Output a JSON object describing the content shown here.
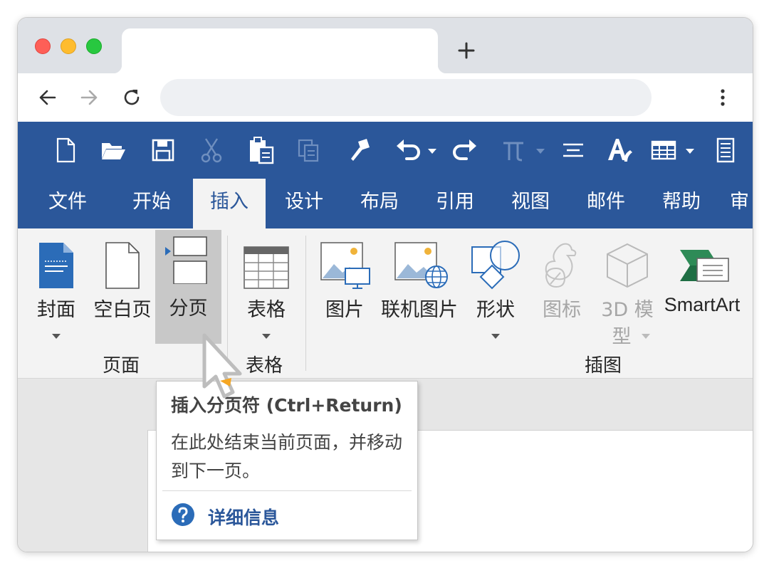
{
  "browser": {
    "new_tab_symbol": "+",
    "address": ""
  },
  "quick_access": {
    "icons": [
      "new-document-icon",
      "open-folder-icon",
      "save-icon",
      "cut-icon",
      "paste-icon",
      "copy-icon",
      "format-painter-icon",
      "undo-icon",
      "undo-dropdown-icon",
      "redo-icon",
      "equation-icon",
      "equation-dropdown-icon",
      "center-align-icon",
      "text-effects-icon",
      "table-icon",
      "table-dropdown-icon",
      "page-view-icon"
    ]
  },
  "ribbon_tabs": [
    {
      "label": "文件",
      "active": false
    },
    {
      "label": "开始",
      "active": false
    },
    {
      "label": "插入",
      "active": true
    },
    {
      "label": "设计",
      "active": false
    },
    {
      "label": "布局",
      "active": false
    },
    {
      "label": "引用",
      "active": false
    },
    {
      "label": "视图",
      "active": false
    },
    {
      "label": "邮件",
      "active": false
    },
    {
      "label": "帮助",
      "active": false
    },
    {
      "label": "审",
      "active": false
    }
  ],
  "ribbon": {
    "pages_group": {
      "label": "页面",
      "cover": "封面",
      "blank_page": "空白页",
      "page_break": "分页"
    },
    "tables_group": {
      "label": "表格",
      "table": "表格"
    },
    "illustrations_group": {
      "label": "插图",
      "pictures": "图片",
      "online_pictures": "联机图片",
      "shapes": "形状",
      "icons": "图标",
      "models_line1": "3D 模",
      "models_line2": "型",
      "smartart": "SmartArt"
    }
  },
  "tooltip": {
    "title": "插入分页符 (Ctrl+Return)",
    "body": "在此处结束当前页面，并移动到下一页。",
    "help_link": "详细信息"
  },
  "colors": {
    "word_blue": "#2b579a",
    "ribbon_bg": "#f3f3f3",
    "hover_gray": "#c8c8c8",
    "cursor_accent": "#f5a623"
  }
}
